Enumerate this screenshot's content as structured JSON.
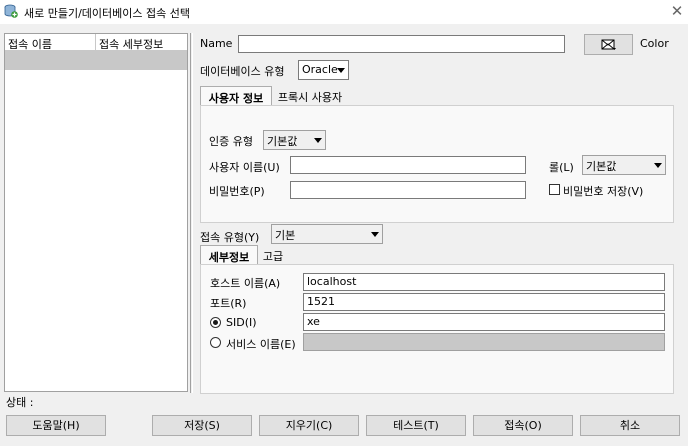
{
  "window": {
    "title": "새로 만들기/데이터베이스 접속 선택",
    "close": "✕"
  },
  "connection_list": {
    "col_name": "접속 이름",
    "col_details": "접속 세부정보"
  },
  "form": {
    "name_label": "Name",
    "name_value": "",
    "color_label": "Color",
    "db_type_label": "데이터베이스 유형",
    "db_type_value": "Oracle"
  },
  "auth_tabs": {
    "user_info": "사용자 정보",
    "proxy_user": "프록시 사용자"
  },
  "auth": {
    "auth_type_label": "인증 유형",
    "auth_type_value": "기본값",
    "username_label": "사용자 이름(U)",
    "username_value": "",
    "role_label": "롤(L)",
    "role_value": "기본값",
    "password_label": "비밀번호(P)",
    "password_value": "",
    "save_password_label": "비밀번호 저장(V)",
    "save_password_checked": false
  },
  "connection_type": {
    "label": "접속 유형(Y)",
    "value": "기본"
  },
  "detail_tabs": {
    "details": "세부정보",
    "advanced": "고급"
  },
  "details": {
    "hostname_label": "호스트 이름(A)",
    "hostname_value": "localhost",
    "port_label": "포트(R)",
    "port_value": "1521",
    "sid_label": "SID(I)",
    "sid_value": "xe",
    "sid_selected": true,
    "service_label": "서비스 이름(E)",
    "service_value": ""
  },
  "status": {
    "label": "상태 :"
  },
  "buttons": {
    "help": "도움말(H)",
    "save": "저장(S)",
    "clear": "지우기(C)",
    "test": "테스트(T)",
    "connect": "접속(O)",
    "cancel": "취소"
  },
  "colors": {
    "list_selection": "#c8c8c8",
    "dialog_bg": "#f0f0f0",
    "panel_bg": "#f9f9f9"
  }
}
